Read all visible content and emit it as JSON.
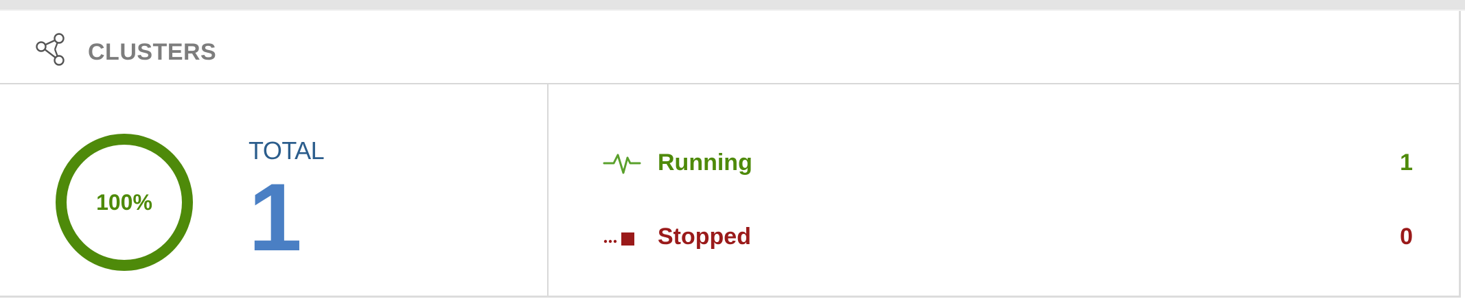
{
  "header": {
    "title": "CLUSTERS",
    "icon": "cluster-icon"
  },
  "summary": {
    "percent_label": "100%",
    "percent": 1.0,
    "total_label": "TOTAL",
    "total_value": "1"
  },
  "statuses": [
    {
      "label": "Running",
      "count": "1",
      "icon": "heartbeat-icon",
      "color": "#4e8a0a"
    },
    {
      "label": "Stopped",
      "count": "0",
      "icon": "stopped-icon",
      "color": "#9a1a1a"
    }
  ],
  "colors": {
    "ring": "#4e8a0a",
    "total_label": "#2b5d8c",
    "total_value": "#4a7fc4",
    "header_text": "#7d7d7d"
  }
}
